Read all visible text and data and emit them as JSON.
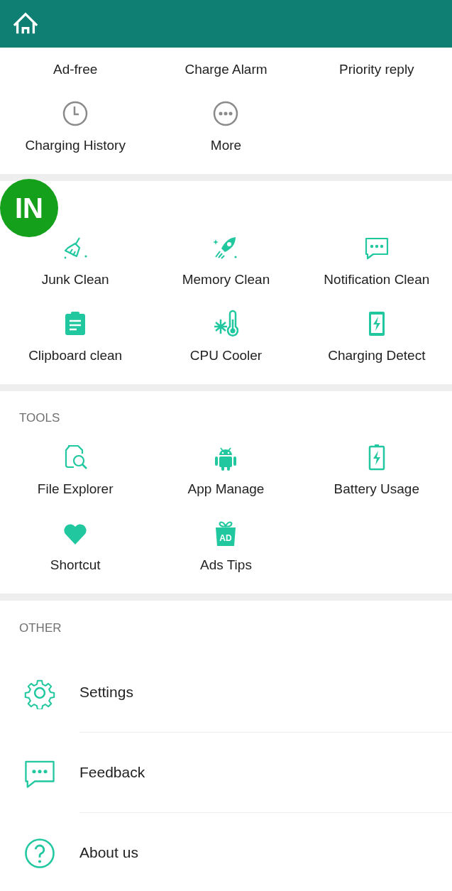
{
  "sections": [
    {
      "items": [
        {
          "label": "Ad-free"
        },
        {
          "label": "Charge Alarm"
        },
        {
          "label": "Priority reply"
        },
        {
          "label": "Charging History"
        },
        {
          "label": "More"
        }
      ]
    },
    {
      "items": [
        {
          "label": "Junk Clean"
        },
        {
          "label": "Memory Clean"
        },
        {
          "label": "Notification Clean"
        },
        {
          "label": "Clipboard clean"
        },
        {
          "label": "CPU Cooler"
        },
        {
          "label": "Charging Detect"
        }
      ]
    },
    {
      "title": "TOOLS",
      "items": [
        {
          "label": "File Explorer"
        },
        {
          "label": "App Manage"
        },
        {
          "label": "Battery Usage"
        },
        {
          "label": "Shortcut"
        },
        {
          "label": "Ads Tips",
          "icon_text": "AD"
        }
      ]
    }
  ],
  "other": {
    "title": "OTHER",
    "rows": [
      {
        "label": "Settings"
      },
      {
        "label": "Feedback"
      },
      {
        "label": "About us"
      }
    ]
  },
  "overlay_badge": {
    "text": "IN"
  }
}
